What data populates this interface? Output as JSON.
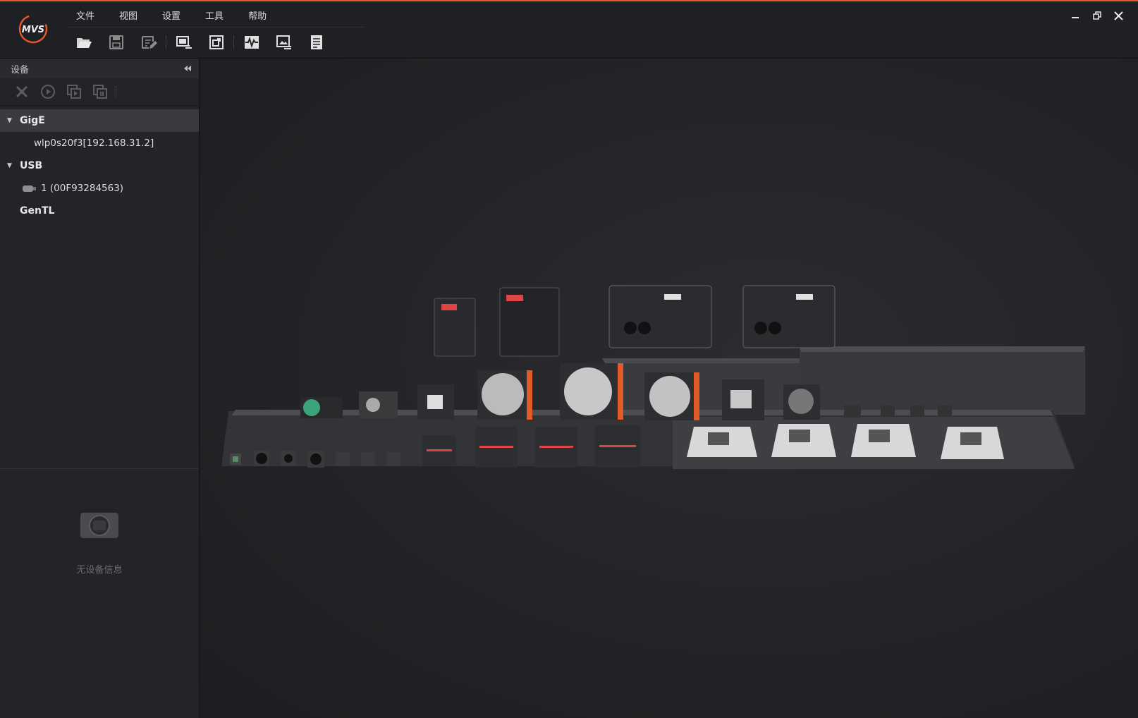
{
  "colors": {
    "accent": "#e8592a",
    "background": "#1c1d20",
    "panel": "#232427"
  },
  "app": {
    "logo_text": "MVS"
  },
  "menu": {
    "items": [
      "文件",
      "视图",
      "设置",
      "工具",
      "帮助"
    ]
  },
  "toolbar": {
    "icons": [
      "folder-open-icon",
      "save-icon",
      "save-as-icon",
      "device-settings-icon",
      "fit-window-icon",
      "waveform-icon",
      "image-info-icon",
      "document-list-icon"
    ]
  },
  "window_controls": [
    "minimize-icon",
    "restore-icon",
    "close-icon"
  ],
  "device_panel": {
    "title": "设备",
    "tools": [
      "disconnect-icon",
      "play-icon",
      "start-all-icon",
      "stop-all-icon"
    ],
    "tree": [
      {
        "label": "GigE",
        "expanded": true,
        "selected": true,
        "children": [
          {
            "label": "wlp0s20f3[192.168.31.2]"
          }
        ]
      },
      {
        "label": "USB",
        "expanded": true,
        "children": [
          {
            "label": "1 (00F93284563)",
            "icon": "usb-device-icon"
          }
        ]
      },
      {
        "label": "GenTL",
        "expanded": false,
        "children": []
      }
    ]
  },
  "device_info": {
    "empty_text": "无设备信息",
    "icon": "camera-icon"
  },
  "main": {
    "hero_image": "camera-product-lineup"
  }
}
